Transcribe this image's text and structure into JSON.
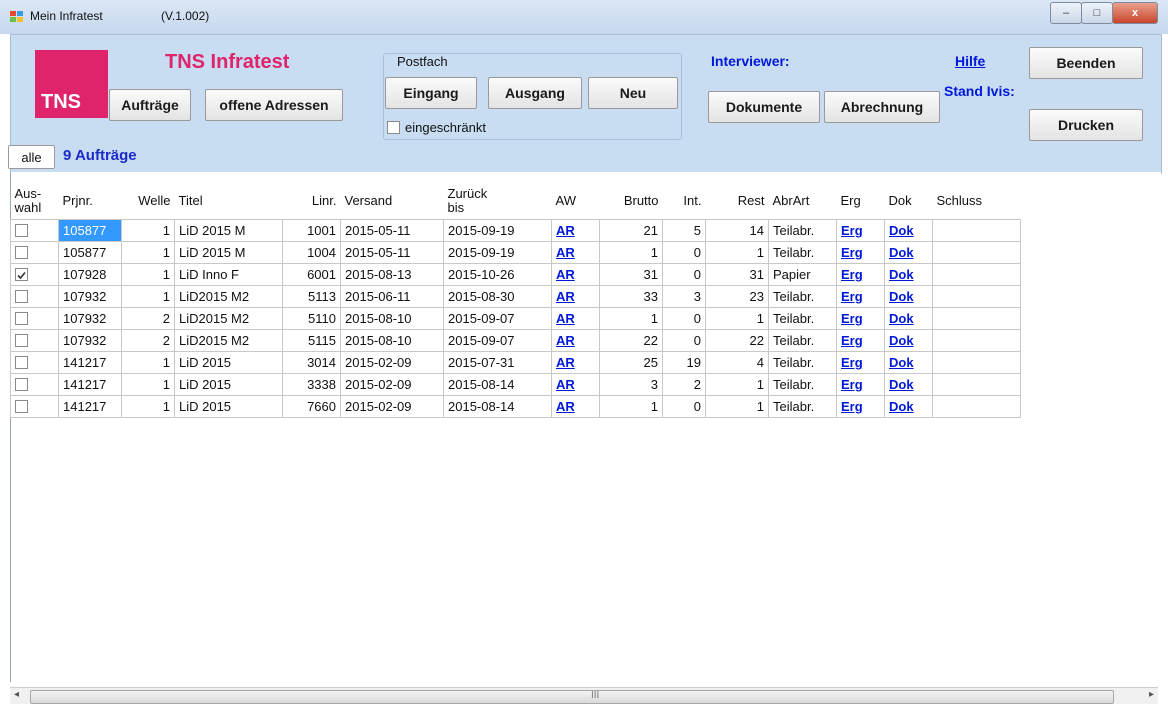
{
  "window": {
    "app_name": "Mein Infratest",
    "version": "(V.1.002)",
    "min": "–",
    "max": "□",
    "close": "x"
  },
  "logo": {
    "text": "TNS",
    "brand": "TNS Infratest"
  },
  "buttons": {
    "auftraege": "Aufträge",
    "offene_adressen": "offene Adressen",
    "eingang": "Eingang",
    "ausgang": "Ausgang",
    "neu": "Neu",
    "dokumente": "Dokumente",
    "abrechnung": "Abrechnung",
    "beenden": "Beenden",
    "drucken": "Drucken",
    "alle": "alle"
  },
  "postfach": {
    "label": "Postfach",
    "checkbox_label": "eingeschränkt"
  },
  "header_links": {
    "interviewer": "Interviewer:",
    "hilfe": "Hilfe",
    "stand_ivis": "Stand Ivis:"
  },
  "summary": {
    "count": "9 Aufträge"
  },
  "table": {
    "columns": [
      "Aus-\nwahl",
      "Prjnr.",
      "Welle",
      "Titel",
      "Linr.",
      "Versand",
      "Zurück\nbis",
      "AW",
      "Brutto",
      "Int.",
      "Rest",
      "AbrArt",
      "Erg",
      "Dok",
      "Schluss"
    ],
    "rows": [
      {
        "checked": false,
        "prjnr": "105877",
        "welle": "1",
        "titel": "LiD 2015 M",
        "linr": "1001",
        "versand": "2015-05-11",
        "zurueck": "2015-09-19",
        "aw": "AR",
        "brutto": "21",
        "int": "5",
        "rest": "14",
        "abrart": "Teilabr.",
        "erg": "Erg",
        "dok": "Dok",
        "schluss": ""
      },
      {
        "checked": false,
        "prjnr": "105877",
        "welle": "1",
        "titel": "LiD 2015 M",
        "linr": "1004",
        "versand": "2015-05-11",
        "zurueck": "2015-09-19",
        "aw": "AR",
        "brutto": "1",
        "int": "0",
        "rest": "1",
        "abrart": "Teilabr.",
        "erg": "Erg",
        "dok": "Dok",
        "schluss": ""
      },
      {
        "checked": true,
        "prjnr": "107928",
        "welle": "1",
        "titel": "LiD Inno F",
        "linr": "6001",
        "versand": "2015-08-13",
        "zurueck": "2015-10-26",
        "aw": "AR",
        "brutto": "31",
        "int": "0",
        "rest": "31",
        "abrart": "Papier",
        "erg": "Erg",
        "dok": "Dok",
        "schluss": ""
      },
      {
        "checked": false,
        "prjnr": "107932",
        "welle": "1",
        "titel": "LiD2015 M2",
        "linr": "5113",
        "versand": "2015-06-11",
        "zurueck": "2015-08-30",
        "aw": "AR",
        "brutto": "33",
        "int": "3",
        "rest": "23",
        "abrart": "Teilabr.",
        "erg": "Erg",
        "dok": "Dok",
        "schluss": ""
      },
      {
        "checked": false,
        "prjnr": "107932",
        "welle": "2",
        "titel": "LiD2015 M2",
        "linr": "5110",
        "versand": "2015-08-10",
        "zurueck": "2015-09-07",
        "aw": "AR",
        "brutto": "1",
        "int": "0",
        "rest": "1",
        "abrart": "Teilabr.",
        "erg": "Erg",
        "dok": "Dok",
        "schluss": ""
      },
      {
        "checked": false,
        "prjnr": "107932",
        "welle": "2",
        "titel": "LiD2015 M2",
        "linr": "5115",
        "versand": "2015-08-10",
        "zurueck": "2015-09-07",
        "aw": "AR",
        "brutto": "22",
        "int": "0",
        "rest": "22",
        "abrart": "Teilabr.",
        "erg": "Erg",
        "dok": "Dok",
        "schluss": ""
      },
      {
        "checked": false,
        "prjnr": "141217",
        "welle": "1",
        "titel": "LiD 2015",
        "linr": "3014",
        "versand": "2015-02-09",
        "zurueck": "2015-07-31",
        "aw": "AR",
        "brutto": "25",
        "int": "19",
        "rest": "4",
        "abrart": "Teilabr.",
        "erg": "Erg",
        "dok": "Dok",
        "schluss": ""
      },
      {
        "checked": false,
        "prjnr": "141217",
        "welle": "1",
        "titel": "LiD 2015",
        "linr": "3338",
        "versand": "2015-02-09",
        "zurueck": "2015-08-14",
        "aw": "AR",
        "brutto": "3",
        "int": "2",
        "rest": "1",
        "abrart": "Teilabr.",
        "erg": "Erg",
        "dok": "Dok",
        "schluss": ""
      },
      {
        "checked": false,
        "prjnr": "141217",
        "welle": "1",
        "titel": "LiD 2015",
        "linr": "7660",
        "versand": "2015-02-09",
        "zurueck": "2015-08-14",
        "aw": "AR",
        "brutto": "1",
        "int": "0",
        "rest": "1",
        "abrart": "Teilabr.",
        "erg": "Erg",
        "dok": "Dok",
        "schluss": ""
      }
    ]
  },
  "scrollbar": {
    "left_arrow": "◂",
    "right_arrow": "▸",
    "grip": "III"
  },
  "colors": {
    "brand": "#e0246b",
    "link": "#0018d8",
    "toolbar": "#c8dcf2",
    "selection": "#3399ff"
  }
}
